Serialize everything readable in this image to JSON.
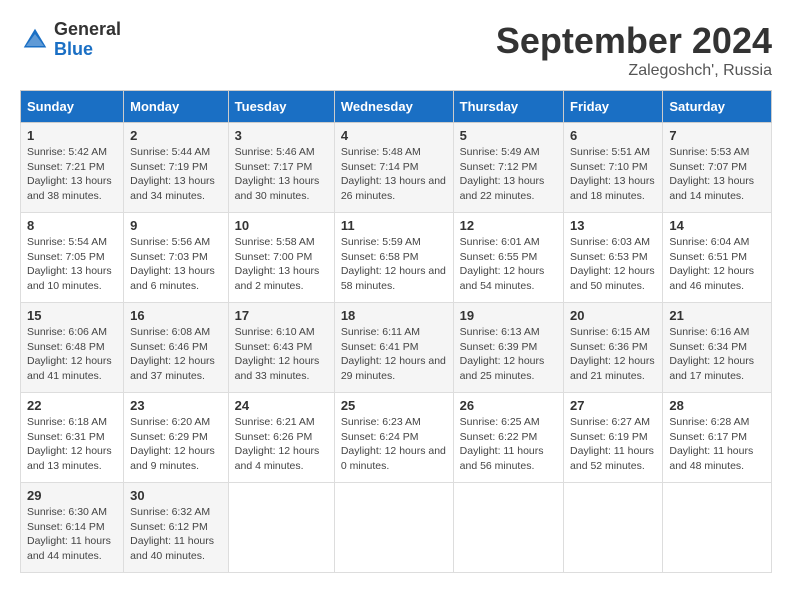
{
  "header": {
    "logo_general": "General",
    "logo_blue": "Blue",
    "title": "September 2024",
    "location": "Zalegoshch', Russia"
  },
  "days_of_week": [
    "Sunday",
    "Monday",
    "Tuesday",
    "Wednesday",
    "Thursday",
    "Friday",
    "Saturday"
  ],
  "weeks": [
    [
      {
        "day": "1",
        "sunrise": "5:42 AM",
        "sunset": "7:21 PM",
        "daylight": "13 hours and 38 minutes."
      },
      {
        "day": "2",
        "sunrise": "5:44 AM",
        "sunset": "7:19 PM",
        "daylight": "13 hours and 34 minutes."
      },
      {
        "day": "3",
        "sunrise": "5:46 AM",
        "sunset": "7:17 PM",
        "daylight": "13 hours and 30 minutes."
      },
      {
        "day": "4",
        "sunrise": "5:48 AM",
        "sunset": "7:14 PM",
        "daylight": "13 hours and 26 minutes."
      },
      {
        "day": "5",
        "sunrise": "5:49 AM",
        "sunset": "7:12 PM",
        "daylight": "13 hours and 22 minutes."
      },
      {
        "day": "6",
        "sunrise": "5:51 AM",
        "sunset": "7:10 PM",
        "daylight": "13 hours and 18 minutes."
      },
      {
        "day": "7",
        "sunrise": "5:53 AM",
        "sunset": "7:07 PM",
        "daylight": "13 hours and 14 minutes."
      }
    ],
    [
      {
        "day": "8",
        "sunrise": "5:54 AM",
        "sunset": "7:05 PM",
        "daylight": "13 hours and 10 minutes."
      },
      {
        "day": "9",
        "sunrise": "5:56 AM",
        "sunset": "7:03 PM",
        "daylight": "13 hours and 6 minutes."
      },
      {
        "day": "10",
        "sunrise": "5:58 AM",
        "sunset": "7:00 PM",
        "daylight": "13 hours and 2 minutes."
      },
      {
        "day": "11",
        "sunrise": "5:59 AM",
        "sunset": "6:58 PM",
        "daylight": "12 hours and 58 minutes."
      },
      {
        "day": "12",
        "sunrise": "6:01 AM",
        "sunset": "6:55 PM",
        "daylight": "12 hours and 54 minutes."
      },
      {
        "day": "13",
        "sunrise": "6:03 AM",
        "sunset": "6:53 PM",
        "daylight": "12 hours and 50 minutes."
      },
      {
        "day": "14",
        "sunrise": "6:04 AM",
        "sunset": "6:51 PM",
        "daylight": "12 hours and 46 minutes."
      }
    ],
    [
      {
        "day": "15",
        "sunrise": "6:06 AM",
        "sunset": "6:48 PM",
        "daylight": "12 hours and 41 minutes."
      },
      {
        "day": "16",
        "sunrise": "6:08 AM",
        "sunset": "6:46 PM",
        "daylight": "12 hours and 37 minutes."
      },
      {
        "day": "17",
        "sunrise": "6:10 AM",
        "sunset": "6:43 PM",
        "daylight": "12 hours and 33 minutes."
      },
      {
        "day": "18",
        "sunrise": "6:11 AM",
        "sunset": "6:41 PM",
        "daylight": "12 hours and 29 minutes."
      },
      {
        "day": "19",
        "sunrise": "6:13 AM",
        "sunset": "6:39 PM",
        "daylight": "12 hours and 25 minutes."
      },
      {
        "day": "20",
        "sunrise": "6:15 AM",
        "sunset": "6:36 PM",
        "daylight": "12 hours and 21 minutes."
      },
      {
        "day": "21",
        "sunrise": "6:16 AM",
        "sunset": "6:34 PM",
        "daylight": "12 hours and 17 minutes."
      }
    ],
    [
      {
        "day": "22",
        "sunrise": "6:18 AM",
        "sunset": "6:31 PM",
        "daylight": "12 hours and 13 minutes."
      },
      {
        "day": "23",
        "sunrise": "6:20 AM",
        "sunset": "6:29 PM",
        "daylight": "12 hours and 9 minutes."
      },
      {
        "day": "24",
        "sunrise": "6:21 AM",
        "sunset": "6:26 PM",
        "daylight": "12 hours and 4 minutes."
      },
      {
        "day": "25",
        "sunrise": "6:23 AM",
        "sunset": "6:24 PM",
        "daylight": "12 hours and 0 minutes."
      },
      {
        "day": "26",
        "sunrise": "6:25 AM",
        "sunset": "6:22 PM",
        "daylight": "11 hours and 56 minutes."
      },
      {
        "day": "27",
        "sunrise": "6:27 AM",
        "sunset": "6:19 PM",
        "daylight": "11 hours and 52 minutes."
      },
      {
        "day": "28",
        "sunrise": "6:28 AM",
        "sunset": "6:17 PM",
        "daylight": "11 hours and 48 minutes."
      }
    ],
    [
      {
        "day": "29",
        "sunrise": "6:30 AM",
        "sunset": "6:14 PM",
        "daylight": "11 hours and 44 minutes."
      },
      {
        "day": "30",
        "sunrise": "6:32 AM",
        "sunset": "6:12 PM",
        "daylight": "11 hours and 40 minutes."
      },
      null,
      null,
      null,
      null,
      null
    ]
  ]
}
